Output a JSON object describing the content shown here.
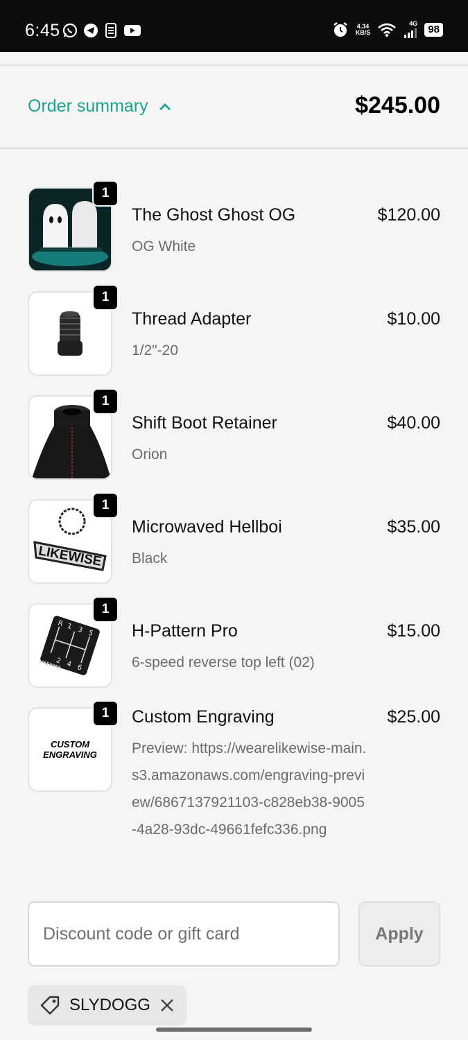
{
  "status_bar": {
    "time": "6:45",
    "net_speed_value": "4.34",
    "net_speed_unit": "KB/S",
    "network": "4G",
    "battery": "98",
    "icons": [
      "whatsapp-icon",
      "telegram-icon",
      "app-icon",
      "youtube-icon",
      "alarm-icon",
      "wifi-icon",
      "signal-icon",
      "battery-icon"
    ]
  },
  "summary": {
    "toggle_label": "Order summary",
    "total": "$245.00"
  },
  "items": [
    {
      "name": "The Ghost Ghost OG",
      "variant": "OG White",
      "price": "$120.00",
      "qty": "1",
      "thumb": "ghost-knobs"
    },
    {
      "name": "Thread Adapter",
      "variant": "1/2\"-20",
      "price": "$10.00",
      "qty": "1",
      "thumb": "thread-adapter"
    },
    {
      "name": "Shift Boot Retainer",
      "variant": "Orion",
      "price": "$40.00",
      "qty": "1",
      "thumb": "shift-boot"
    },
    {
      "name": "Microwaved Hellboi",
      "variant": "Black",
      "price": "$35.00",
      "qty": "1",
      "thumb": "keychain"
    },
    {
      "name": "H-Pattern Pro",
      "variant": "6-speed reverse top left (02)",
      "price": "$15.00",
      "qty": "1",
      "thumb": "h-pattern"
    },
    {
      "name": "Custom Engraving",
      "variant": "Preview: https://wearelikewise-main.s3.amazonaws.com/engraving-preview/6867137921103-c828eb38-9005-4a28-93dc-49661fefc336.png",
      "price": "$25.00",
      "qty": "1",
      "thumb": "custom-engraving"
    }
  ],
  "thumb_text": {
    "custom_engraving_line1": "CUSTOM",
    "custom_engraving_line2": "ENGRAVING",
    "keychain_text": "LIKEWISE",
    "shift_pattern": [
      "R",
      "1",
      "3",
      "5",
      "2",
      "4",
      "6"
    ],
    "shift_brand": "LIKEWISE"
  },
  "discount": {
    "placeholder": "Discount code or gift card",
    "apply_label": "Apply",
    "applied_code": "SLYDOGG"
  },
  "colors": {
    "accent": "#1aa390",
    "background": "#f5f5f5",
    "status_bar": "#0d0d0d"
  }
}
